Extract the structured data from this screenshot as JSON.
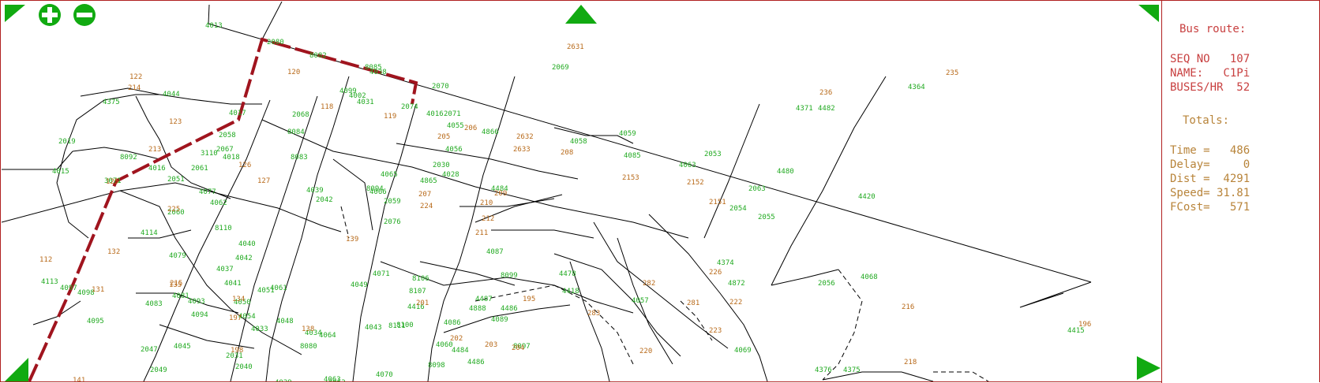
{
  "controls": {
    "zoom_in_icon": "plus-circle",
    "zoom_out_icon": "minus-circle",
    "pan_icons": [
      "triangle-up",
      "triangle-corner"
    ]
  },
  "colors": {
    "route": "#a0141e",
    "node_label": "#22aa22",
    "stop_label": "#b86a1a",
    "panel_text": "#c84040",
    "controls": "#11aa11"
  },
  "panel": {
    "heading": "Bus route:",
    "seq_no": "SEQ NO   107",
    "name": "NAME:   C1Pi",
    "buses_hr": "BUSES/HR  52",
    "totals_heading": "Totals:",
    "time": "Time =   486",
    "delay": "Delay=     0",
    "dist": "Dist =  4291",
    "speed": "Speed= 31.81",
    "fcost": "FCost=   571"
  },
  "map": {
    "green_labels": [
      "4013",
      "2080",
      "8082",
      "8085",
      "2070",
      "2069",
      "4364",
      "4371",
      "4375",
      "4044",
      "2019",
      "4015",
      "4017",
      "2058",
      "2067",
      "2068",
      "8084",
      "8083",
      "8092",
      "4016",
      "3071",
      "4018",
      "3110",
      "2061",
      "2051",
      "2060",
      "4114",
      "4113",
      "4097",
      "4098",
      "4095",
      "4099",
      "4002",
      "4031",
      "4038",
      "4016",
      "2074",
      "2071",
      "2059",
      "2076",
      "4065",
      "4066",
      "4062",
      "4077",
      "8110",
      "4083",
      "4081",
      "4093",
      "4094",
      "4079",
      "2049",
      "2047",
      "2042",
      "4039",
      "4037",
      "4040",
      "4042",
      "4041",
      "4050",
      "4054",
      "4051",
      "4055",
      "4056",
      "2030",
      "4865",
      "4866",
      "4063",
      "4061",
      "4033",
      "4048",
      "8080",
      "2052",
      "2040",
      "4045",
      "4029",
      "2031",
      "4034",
      "4028",
      "4087",
      "4089",
      "8098",
      "8094",
      "4049",
      "4064",
      "4063",
      "4070",
      "4043",
      "8111",
      "8100",
      "8107",
      "8106",
      "4888",
      "4487",
      "4486",
      "8097",
      "8099",
      "4058",
      "4059",
      "4085",
      "2053",
      "2054",
      "2063",
      "2055",
      "2056",
      "4068",
      "4069",
      "4057",
      "4060",
      "4086",
      "4071",
      "4872",
      "4374",
      "4375",
      "4376",
      "4415",
      "4420",
      "4480",
      "4482",
      "4484",
      "4486",
      "4484",
      "4416",
      "4418",
      "4478",
      "4479",
      "4377",
      "4378",
      "2241",
      "4374",
      "4371",
      "4376",
      "2064",
      "4067",
      "4071",
      "4084",
      "4077",
      "4076",
      "4075",
      "4074"
    ],
    "orange_labels": [
      "2631",
      "236",
      "235",
      "118",
      "119",
      "120",
      "122",
      "123",
      "125",
      "126",
      "127",
      "131",
      "132",
      "134",
      "135",
      "138",
      "139",
      "141",
      "112",
      "2152",
      "2151",
      "2153",
      "2632",
      "2633",
      "205",
      "206",
      "207",
      "208",
      "209",
      "210",
      "211",
      "212",
      "213",
      "214",
      "215",
      "216",
      "218",
      "220",
      "222",
      "223",
      "224",
      "225",
      "226",
      "281",
      "282",
      "283",
      "201",
      "202",
      "203",
      "204",
      "195",
      "196",
      "197",
      "198",
      "199",
      "200",
      "217",
      "219",
      "153",
      "3"
    ]
  }
}
